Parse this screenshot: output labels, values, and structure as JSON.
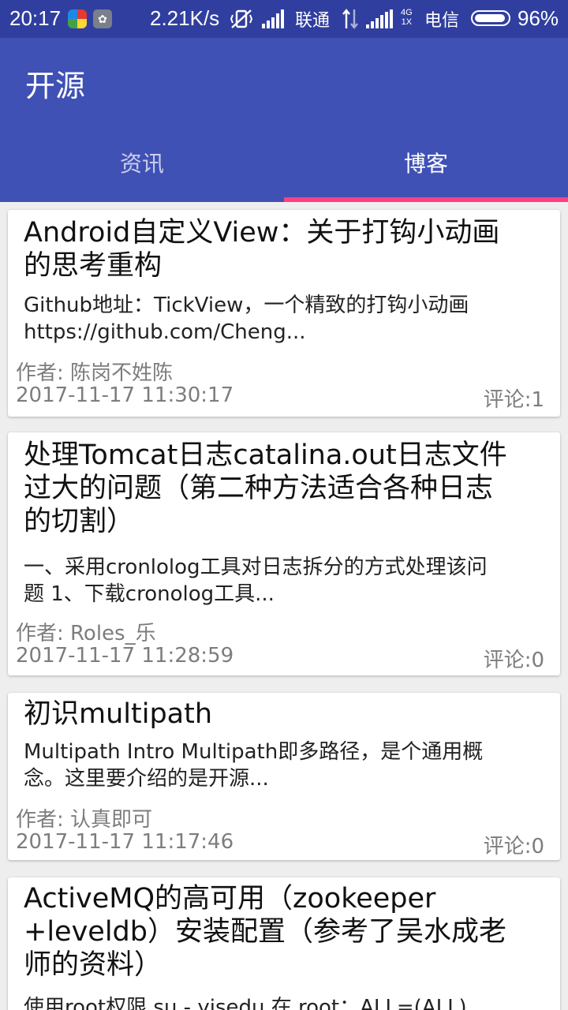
{
  "status_bar": {
    "time": "20:17",
    "speed": "2.21K/s",
    "carrier1": "联通",
    "network_type": [
      "4G",
      "1X"
    ],
    "carrier2": "电信",
    "battery_percent": "96%",
    "battery_level": 0.96
  },
  "app_bar": {
    "title": "开源",
    "tabs": [
      {
        "label": "资讯",
        "selected": false
      },
      {
        "label": "博客",
        "selected": true
      }
    ]
  },
  "colors": {
    "primary": "#3f51b5",
    "primary_dark": "#303f9f",
    "accent": "#ff4081"
  },
  "posts": [
    {
      "title_lines": [
        "Android自定义View：关于打钩小动画",
        "的思考重构"
      ],
      "desc_lines": [
        "Github地址：TickView，一个精致的打钩小动画",
        "https://github.com/Cheng..."
      ],
      "author": "作者: 陈岗不姓陈",
      "date": "2017-11-17 11:30:17",
      "comments": "评论:1"
    },
    {
      "title_lines": [
        "处理Tomcat日志catalina.out日志文件",
        "过大的问题（第二种方法适合各种日志",
        "的切割）"
      ],
      "desc_lines": [
        "一、采用cronlolog工具对日志拆分的方式处理该问",
        "题 1、下载cronolog工具..."
      ],
      "author": "作者: Roles_乐",
      "date": "2017-11-17 11:28:59",
      "comments": "评论:0"
    },
    {
      "title_lines": [
        "初识multipath"
      ],
      "desc_lines": [
        "Multipath Intro Multipath即多路径，是个通用概",
        "念。这里要介绍的是开源..."
      ],
      "author": "作者: 认真即可",
      "date": "2017-11-17 11:17:46",
      "comments": "评论:0"
    },
    {
      "title_lines": [
        "ActiveMQ的高可用（zookeeper",
        "+leveldb）安装配置（参考了吴水成老",
        "师的资料）"
      ],
      "desc_lines": [
        "使用root权限 su - yisedu 在 root：ALL=(ALL)"
      ],
      "author": "",
      "date": "",
      "comments": ""
    }
  ]
}
